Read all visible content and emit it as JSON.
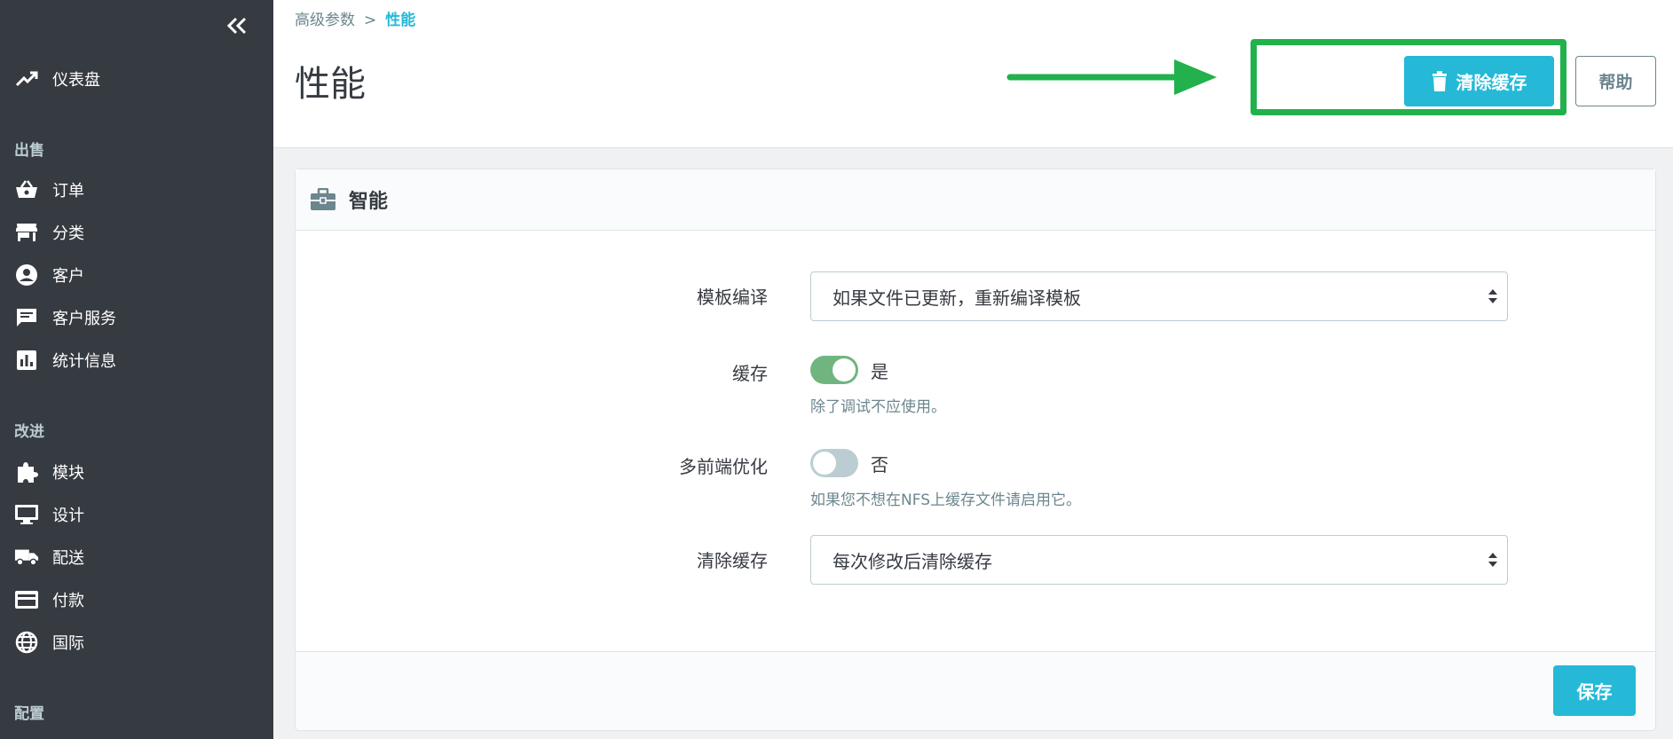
{
  "sidebar": {
    "items_top": [
      {
        "label": "仪表盘",
        "icon": "trending-up-icon"
      }
    ],
    "sections": [
      {
        "title": "出售",
        "items": [
          {
            "label": "订单",
            "icon": "basket-icon"
          },
          {
            "label": "分类",
            "icon": "store-icon"
          },
          {
            "label": "客户",
            "icon": "account-circle-icon"
          },
          {
            "label": "客户服务",
            "icon": "chat-icon"
          },
          {
            "label": "统计信息",
            "icon": "bar-chart-icon"
          }
        ]
      },
      {
        "title": "改进",
        "items": [
          {
            "label": "模块",
            "icon": "puzzle-icon"
          },
          {
            "label": "设计",
            "icon": "desktop-icon"
          },
          {
            "label": "配送",
            "icon": "truck-icon"
          },
          {
            "label": "付款",
            "icon": "credit-card-icon"
          },
          {
            "label": "国际",
            "icon": "globe-icon"
          }
        ]
      },
      {
        "title": "配置",
        "items": []
      }
    ]
  },
  "header": {
    "breadcrumb": {
      "parent": "高级参数",
      "separator": ">",
      "current": "性能"
    },
    "title": "性能",
    "clear_cache_label": "清除缓存",
    "help_label": "帮助"
  },
  "card": {
    "title": "智能",
    "fields": {
      "template_compilation": {
        "label": "模板编译",
        "value": "如果文件已更新，重新编译模板"
      },
      "cache": {
        "label": "缓存",
        "state": "是",
        "help": "除了调试不应使用。"
      },
      "multi_frontend": {
        "label": "多前端优化",
        "state": "否",
        "help": "如果您不想在NFS上缓存文件请启用它。"
      },
      "clear_cache": {
        "label": "清除缓存",
        "value": "每次修改后清除缓存"
      }
    },
    "save_label": "保存"
  },
  "colors": {
    "sidebar_bg": "#363a41",
    "accent": "#25b9d7",
    "toggle_on": "#70b580",
    "highlight": "#22b14c"
  }
}
